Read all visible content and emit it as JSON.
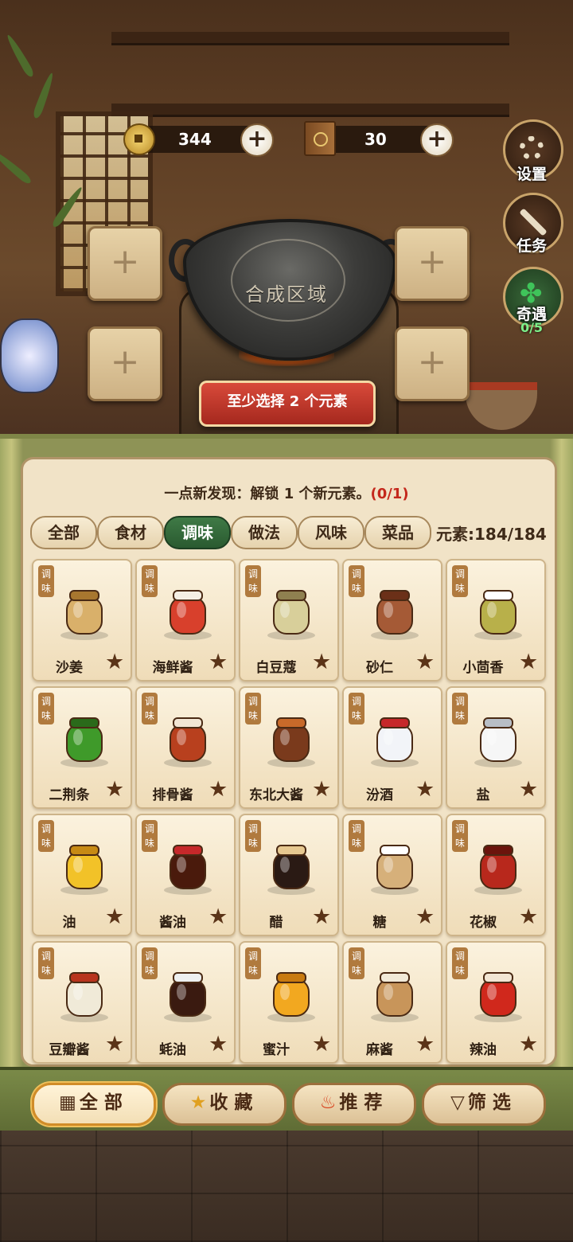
{
  "hud": {
    "coins": "344",
    "books": "30"
  },
  "side_buttons": {
    "settings": "设置",
    "tasks": "任务",
    "encounter": "奇遇",
    "encounter_progress": "0/5"
  },
  "craft": {
    "wok_label": "合成区域",
    "slot_symbol": "+",
    "warning": "至少选择 2 个元素"
  },
  "discovery": {
    "text": "一点新发现：解锁 1 个新元素。",
    "progress": "(0/1)"
  },
  "tabs": [
    {
      "label": "全部",
      "active": false
    },
    {
      "label": "食材",
      "active": false
    },
    {
      "label": "调味",
      "active": true
    },
    {
      "label": "做法",
      "active": false
    },
    {
      "label": "风味",
      "active": false
    },
    {
      "label": "菜品",
      "active": false
    }
  ],
  "element_count": "元素:184/184",
  "card_tag": "调味",
  "items": [
    {
      "name": "沙姜",
      "icon": "ginger-icon"
    },
    {
      "name": "海鲜酱",
      "icon": "seafood-sauce-jar-icon"
    },
    {
      "name": "白豆蔻",
      "icon": "cardamom-icon"
    },
    {
      "name": "砂仁",
      "icon": "amomum-icon"
    },
    {
      "name": "小茴香",
      "icon": "fennel-bowl-icon"
    },
    {
      "name": "二荆条",
      "icon": "green-chili-icon"
    },
    {
      "name": "排骨酱",
      "icon": "rib-sauce-jar-icon"
    },
    {
      "name": "东北大酱",
      "icon": "soybean-paste-pot-icon"
    },
    {
      "name": "汾酒",
      "icon": "liquor-bottle-icon"
    },
    {
      "name": "盐",
      "icon": "salt-shaker-icon"
    },
    {
      "name": "油",
      "icon": "oil-bottle-icon"
    },
    {
      "name": "酱油",
      "icon": "soy-sauce-bottle-icon"
    },
    {
      "name": "醋",
      "icon": "vinegar-bottle-icon"
    },
    {
      "name": "糖",
      "icon": "sugar-sack-icon"
    },
    {
      "name": "花椒",
      "icon": "sichuan-pepper-icon"
    },
    {
      "name": "豆瓣酱",
      "icon": "bean-paste-jar-icon"
    },
    {
      "name": "蚝油",
      "icon": "oyster-sauce-bottle-icon"
    },
    {
      "name": "蜜汁",
      "icon": "honey-jar-icon"
    },
    {
      "name": "麻酱",
      "icon": "sesame-paste-jar-icon"
    },
    {
      "name": "辣油",
      "icon": "chili-oil-jar-icon"
    }
  ],
  "bottom_nav": [
    {
      "label": "全部",
      "icon": "grid-icon",
      "active": true
    },
    {
      "label": "收藏",
      "icon": "star-icon",
      "active": false
    },
    {
      "label": "推荐",
      "icon": "fire-icon",
      "active": false
    },
    {
      "label": "筛选",
      "icon": "filter-icon",
      "active": false
    }
  ],
  "colors": {
    "active_tab": "#2f6a36",
    "warning_red": "#c4281c",
    "panel": "#f1e3c7",
    "bamboo": "#8e9356"
  }
}
